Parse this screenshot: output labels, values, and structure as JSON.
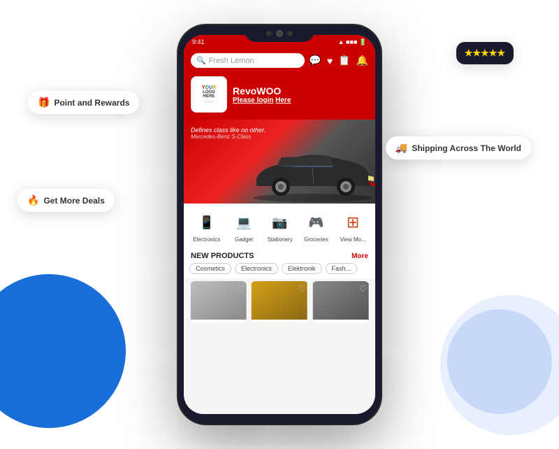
{
  "page": {
    "background": {
      "circle_left_color": "#1a6ed8",
      "circle_right_color": "#dde8ff"
    }
  },
  "phone": {
    "status_bar": {
      "time": "9:41",
      "battery": "■■■",
      "signal": "▲▲▲"
    },
    "search": {
      "placeholder": "Fresh Lemon",
      "icon": "🔍"
    },
    "header_icons": {
      "chat": "💬",
      "heart": "♥",
      "list": "📋",
      "bell": "🔔"
    },
    "user": {
      "logo_line1": "YOUR",
      "logo_line2": "LOGO",
      "logo_line3": "HERE",
      "name": "RevoWOO",
      "login_text": "Please login",
      "login_link": "Here"
    },
    "shipping_badge": {
      "icon": "🚚",
      "text": "Shipping Across The World"
    },
    "banner": {
      "text1": "Defines class like no other.",
      "text2": "Mercedes-Benz S-Class"
    },
    "categories": [
      {
        "id": "electronics",
        "icon": "📱",
        "label": "Electronics",
        "color": "cat-electronics"
      },
      {
        "id": "gadget",
        "icon": "💻",
        "label": "Gadget",
        "color": "cat-gadget"
      },
      {
        "id": "stationery",
        "icon": "📷",
        "label": "Stationery",
        "color": "cat-stationery"
      },
      {
        "id": "groceries",
        "icon": "🎮",
        "label": "Groceries",
        "color": "cat-groceries"
      },
      {
        "id": "more",
        "icon": "⊞",
        "label": "View Mo...",
        "color": "cat-more"
      }
    ],
    "new_products": {
      "title": "NEW PRODUCTS",
      "more_label": "More",
      "filters": [
        "Cosmetics",
        "Electronics",
        "Elektronik",
        "Fash..."
      ]
    }
  },
  "floating_badges": {
    "stars": {
      "rating": "★★★★★"
    },
    "points": {
      "icon": "🎁",
      "text": "Point and Rewards"
    },
    "shipping": {
      "icon": "🚚",
      "text": "Shipping Across The World"
    },
    "deals": {
      "icon": "🔥",
      "text": "Get More Deals"
    }
  }
}
